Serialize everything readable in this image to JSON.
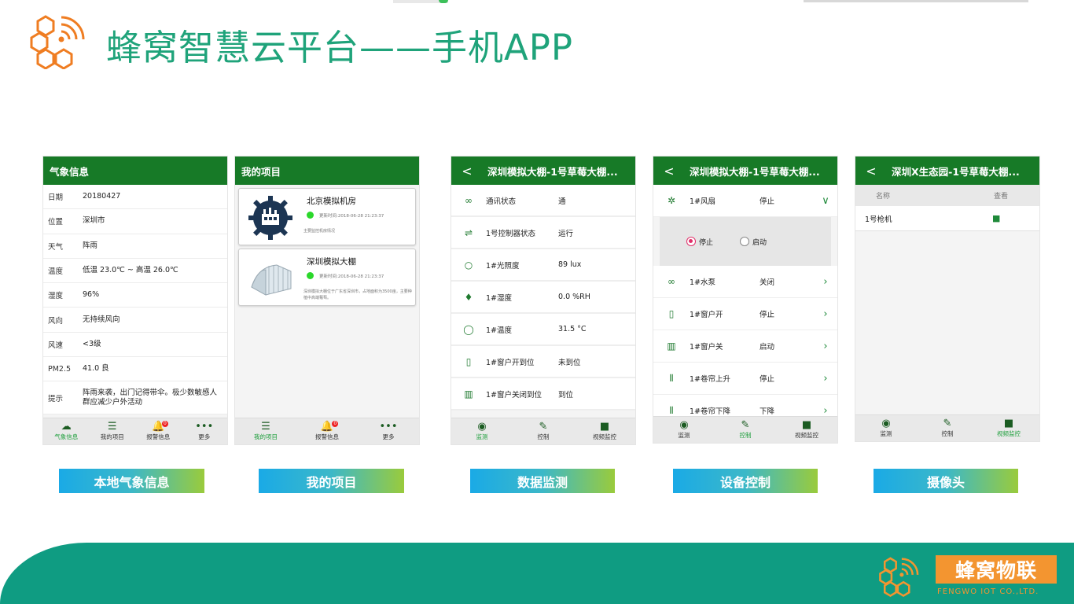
{
  "header": {
    "title": "蜂窝智慧云平台——手机APP"
  },
  "weather": {
    "title": "气象信息",
    "rows": [
      {
        "k": "日期",
        "v": "20180427"
      },
      {
        "k": "位置",
        "v": "深圳市"
      },
      {
        "k": "天气",
        "v": "阵雨"
      },
      {
        "k": "温度",
        "v": "低温 23.0℃ ~ 高温 26.0℃"
      },
      {
        "k": "湿度",
        "v": "96%"
      },
      {
        "k": "风向",
        "v": "无持续风向"
      },
      {
        "k": "风速",
        "v": "<3级"
      },
      {
        "k": "PM2.5",
        "v": "41.0  良"
      },
      {
        "k": "提示",
        "v": "阵雨来袭，出门记得带伞。极少数敏感人群应减少户外活动"
      }
    ],
    "tabs": [
      {
        "label": "气象信息",
        "icon": "weather-icon",
        "glyph": "☁",
        "active": true
      },
      {
        "label": "我的项目",
        "icon": "list-icon",
        "glyph": "☰"
      },
      {
        "label": "报警信息",
        "icon": "bell-icon",
        "glyph": "🔔",
        "badge": "0"
      },
      {
        "label": "更多",
        "icon": "more-icon",
        "glyph": "•••"
      }
    ]
  },
  "projects": {
    "title": "我的项目",
    "cards": [
      {
        "name": "北京模拟机房",
        "time": "更新时间:2018-06-28 21:23:37",
        "desc": "主要监控机房情况"
      },
      {
        "name": "深圳模拟大棚",
        "time": "更新时间:2018-06-28 21:23:37",
        "desc": "深圳模拟大棚位于广东省深圳市，占地面积为3500亩，主要种植中高端葡萄。"
      }
    ],
    "tabs": [
      {
        "label": "我的项目",
        "glyph": "☰",
        "active": true
      },
      {
        "label": "报警信息",
        "glyph": "🔔",
        "badge": "0"
      },
      {
        "label": "更多",
        "glyph": "•••"
      }
    ]
  },
  "monitor": {
    "title": "深圳模拟大棚-1号草莓大棚...",
    "rows": [
      {
        "icon": "link-icon",
        "glyph": "∞",
        "k": "通讯状态",
        "v": "通"
      },
      {
        "icon": "controller-icon",
        "glyph": "⇌",
        "k": "1号控制器状态",
        "v": "运行"
      },
      {
        "icon": "bulb-icon",
        "glyph": "○",
        "k": "1#光照度",
        "v": "89 lux"
      },
      {
        "icon": "drops-icon",
        "glyph": "♦",
        "k": "1#湿度",
        "v": "0.0 %RH"
      },
      {
        "icon": "circle-icon",
        "glyph": "◯",
        "k": "1#温度",
        "v": "31.5 °C"
      },
      {
        "icon": "window-icon",
        "glyph": "▯",
        "k": "1#窗户开到位",
        "v": "未到位"
      },
      {
        "icon": "window-icon",
        "glyph": "▥",
        "k": "1#窗户关闭到位",
        "v": "到位"
      }
    ],
    "tabs": [
      {
        "label": "监测",
        "glyph": "◉",
        "active": true
      },
      {
        "label": "控制",
        "glyph": "✎"
      },
      {
        "label": "视频监控",
        "glyph": "■"
      }
    ]
  },
  "control": {
    "title": "深圳模拟大棚-1号草莓大棚...",
    "first": {
      "k": "1#风扇",
      "v": "停止",
      "arrow": "∨"
    },
    "options": {
      "stop": "停止",
      "start": "启动"
    },
    "rows": [
      {
        "icon": "pump-icon",
        "glyph": "∞",
        "k": "1#水泵",
        "v": "关闭"
      },
      {
        "icon": "window-icon",
        "glyph": "▯",
        "k": "1#窗户开",
        "v": "停止"
      },
      {
        "icon": "window-icon",
        "glyph": "▥",
        "k": "1#窗户关",
        "v": "启动"
      },
      {
        "icon": "curtain-icon",
        "glyph": "⦀",
        "k": "1#卷帘上升",
        "v": "停止"
      },
      {
        "icon": "curtain-icon",
        "glyph": "⦀",
        "k": "1#卷帘下降",
        "v": "下降"
      }
    ],
    "tabs": [
      {
        "label": "监测",
        "glyph": "◉"
      },
      {
        "label": "控制",
        "glyph": "✎",
        "active": true
      },
      {
        "label": "视频监控",
        "glyph": "■"
      }
    ]
  },
  "camera": {
    "title": "深圳X生态园-1号草莓大棚...",
    "head": {
      "k": "名称",
      "v": "查看"
    },
    "rows": [
      {
        "k": "1号枪机",
        "glyph": "■"
      }
    ],
    "tabs": [
      {
        "label": "监测",
        "glyph": "◉"
      },
      {
        "label": "控制",
        "glyph": "✎"
      },
      {
        "label": "视频监控",
        "glyph": "■",
        "active": true
      }
    ]
  },
  "captions": [
    "本地气象信息",
    "我的项目",
    "数据监测",
    "设备控制",
    "摄像头"
  ],
  "footer": {
    "brand": "蜂窝物联",
    "sub": "FENGWO IOT  CO.,LTD."
  }
}
